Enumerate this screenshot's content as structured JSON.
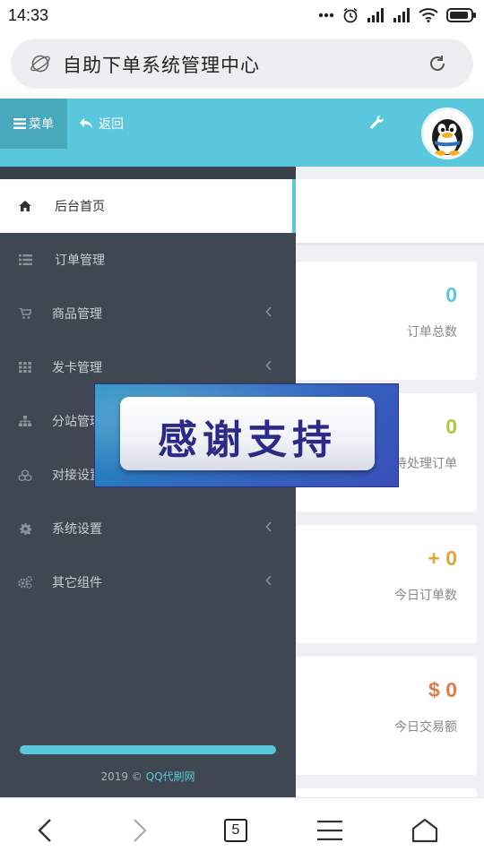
{
  "status_bar": {
    "time": "14:33",
    "icons": [
      "more-dots-icon",
      "alarm-icon",
      "signal-icon",
      "signal-icon",
      "wifi-icon",
      "battery-icon"
    ]
  },
  "browser": {
    "url_title": "自助下单系统管理中心"
  },
  "header": {
    "menu_label": "菜单",
    "back_label": "返回"
  },
  "sidebar": {
    "items": [
      {
        "label": "后台首页",
        "icon": "home-icon",
        "active": true
      },
      {
        "label": "订单管理",
        "icon": "list-icon"
      },
      {
        "label": "商品管理",
        "icon": "cart-icon",
        "has_submenu": true
      },
      {
        "label": "发卡管理",
        "icon": "grid-icon",
        "has_submenu": true
      },
      {
        "label": "分站管理",
        "icon": "sitemap-icon",
        "has_submenu": true
      },
      {
        "label": "对接设置",
        "icon": "cubes-icon",
        "has_submenu": true
      },
      {
        "label": "系统设置",
        "icon": "cog-icon",
        "has_submenu": true
      },
      {
        "label": "其它组件",
        "icon": "cogs-icon",
        "has_submenu": true
      }
    ],
    "footer_year": "2019 ©",
    "footer_brand": "QQ代刷网"
  },
  "stats": [
    {
      "value": "0",
      "label": "订单总数",
      "color": "#5bc7dc"
    },
    {
      "value": "0",
      "label": "待处理订单",
      "color": "#a8c94a"
    },
    {
      "value": "+ 0",
      "label": "今日订单数",
      "color": "#e0a53a"
    },
    {
      "value": "$ 0",
      "label": "今日交易额",
      "color": "#e07a4a"
    }
  ],
  "overlay": {
    "text": "感谢支持"
  },
  "bottom_nav": {
    "tab_count": "5"
  },
  "colors": {
    "accent": "#5bc7dc",
    "sidebar_bg": "#3f4852",
    "menu_btn_bg": "#48a9bd"
  }
}
